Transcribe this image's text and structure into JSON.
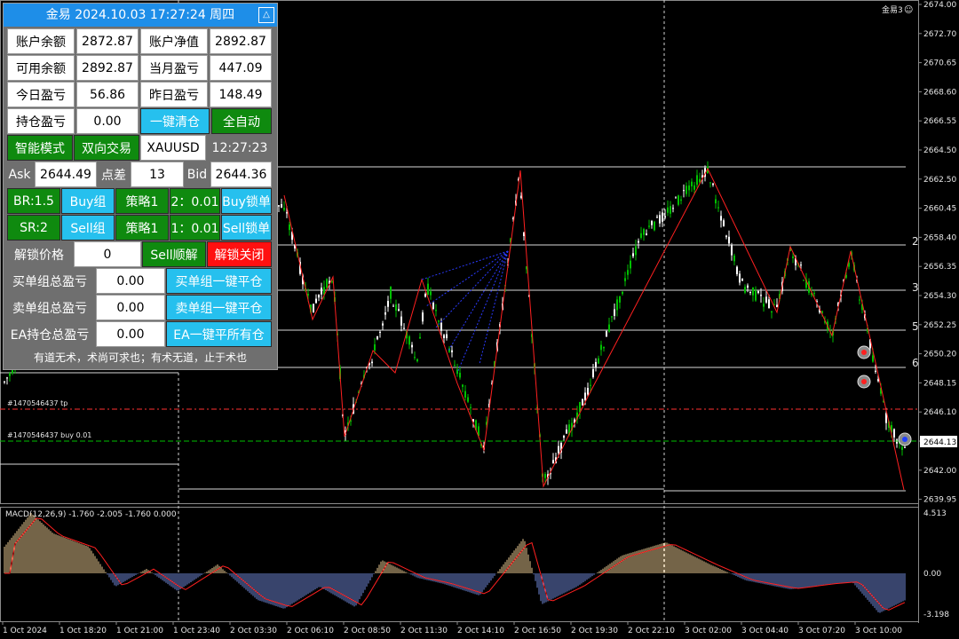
{
  "chart": {
    "symbol_label": "金易3",
    "macd_label": "MACD(12,26,9) -1.760 -2.005 -1.760 0.000",
    "price_ticks": [
      "2674.00",
      "2672.70",
      "2670.65",
      "2668.60",
      "2666.55",
      "2664.50",
      "2662.50",
      "2660.45",
      "2658.40",
      "2656.35",
      "2654.30",
      "2652.25",
      "2650.20",
      "2648.15",
      "2646.10",
      "2644.05",
      "2642.00",
      "2639.95"
    ],
    "current_price": "2644.13",
    "macd_ticks": [
      "4.513",
      "0.00",
      "-3.198"
    ],
    "time_ticks": [
      "1 Oct 2024",
      "1 Oct 18:20",
      "1 Oct 21:00",
      "1 Oct 23:40",
      "2 Oct 03:30",
      "2 Oct 06:10",
      "2 Oct 08:50",
      "2 Oct 11:30",
      "2 Oct 14:10",
      "2 Oct 16:50",
      "2 Oct 19:30",
      "2 Oct 22:10",
      "3 Oct 02:00",
      "3 Oct 04:40",
      "3 Oct 07:20",
      "3 Oct 10:00"
    ],
    "order_tp_label": "#1470546437 tp",
    "order_buy_label": "#1470546437 buy 0.01",
    "right_edge_labels": [
      "2",
      "3",
      "5",
      "6"
    ],
    "colors": {
      "bull": "#00c000",
      "bear": "#ffffff",
      "zigzag": "#ff2020",
      "tp": "#ff3030",
      "buy": "#00c000",
      "macd_bar_pos": "#e8c890",
      "macd_bar_neg": "#6f88d8",
      "signal": "#ff2020"
    }
  },
  "panel": {
    "title": "金易 2024.10.03 17:27:24 周四",
    "minimize_icon": "△",
    "account_balance_label": "账户余额",
    "account_balance": "2872.87",
    "equity_label": "账户净值",
    "equity": "2892.87",
    "free_margin_label": "可用余额",
    "free_margin": "2892.87",
    "month_pl_label": "当月盈亏",
    "month_pl": "447.09",
    "today_pl_label": "今日盈亏",
    "today_pl": "56.86",
    "yesterday_pl_label": "昨日盈亏",
    "yesterday_pl": "148.49",
    "position_pl_label": "持仓盈亏",
    "position_pl": "0.00",
    "close_all_btn": "一键清仓",
    "full_auto_btn": "全自动",
    "smart_mode_btn": "智能模式",
    "two_way_btn": "双向交易",
    "symbol": "XAUUSD",
    "time": "12:27:23",
    "ask_label": "Ask",
    "ask": "2644.49",
    "spread_label": "点差",
    "spread": "13",
    "bid_label": "Bid",
    "bid": "2644.36",
    "br_btn": "BR:1.5",
    "buy_group_btn": "Buy组",
    "strategy1_btn": "策略1",
    "ratio_buy": "2：0.01",
    "buy_lock_btn": "Buy锁单",
    "sr_btn": "SR:2",
    "sell_group_btn": "Sell组",
    "strategy2_btn": "策略1",
    "ratio_sell": "1：0.01",
    "sell_lock_btn": "Sell锁单",
    "unlock_price_label": "解锁价格",
    "unlock_price": "0",
    "sell_unlock_btn": "Sell顺解",
    "unlock_close_btn": "解锁关闭",
    "buy_group_pl_label": "买单组总盈亏",
    "buy_group_pl": "0.00",
    "buy_group_close_btn": "买单组一键平仓",
    "sell_group_pl_label": "卖单组总盈亏",
    "sell_group_pl": "0.00",
    "sell_group_close_btn": "卖单组一键平仓",
    "ea_pl_label": "EA持仓总盈亏",
    "ea_pl": "0.00",
    "ea_close_btn": "EA一键平所有仓",
    "motto": "有道无术，术尚可求也；有术无道，止于术也"
  }
}
